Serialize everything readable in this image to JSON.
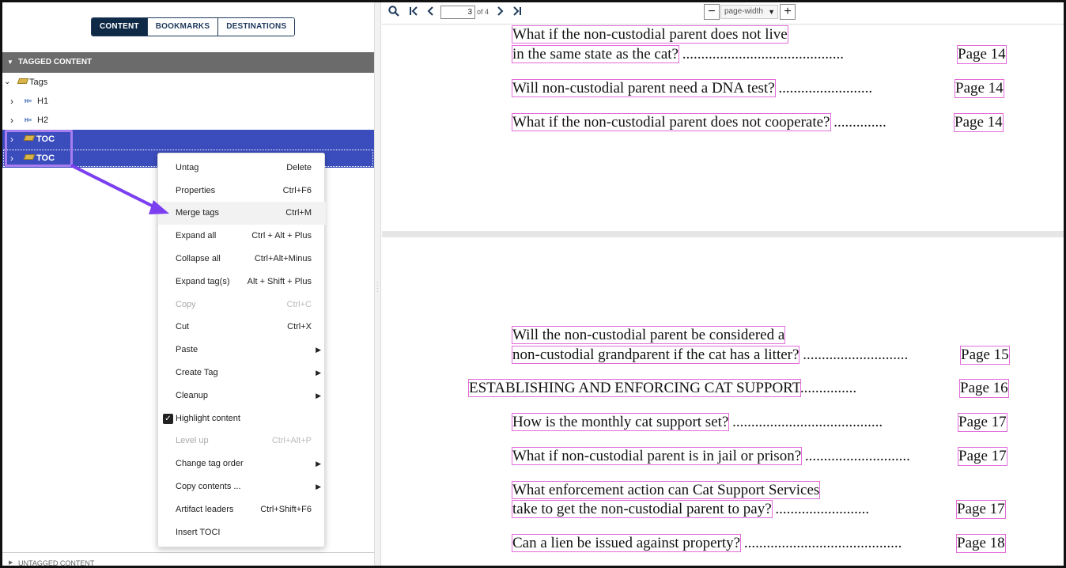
{
  "left_panel": {
    "tabs": [
      {
        "label": "CONTENT",
        "active": true
      },
      {
        "label": "BOOKMARKS",
        "active": false
      },
      {
        "label": "DESTINATIONS",
        "active": false
      }
    ],
    "tagged_header": "TAGGED CONTENT",
    "tree": {
      "root": "Tags",
      "items": [
        {
          "label": "H1",
          "icon": "heading-icon"
        },
        {
          "label": "H2",
          "icon": "heading-icon"
        },
        {
          "label": "TOC",
          "icon": "tag-icon",
          "selected": true
        },
        {
          "label": "TOC",
          "icon": "tag-icon",
          "selected": true
        }
      ]
    },
    "untagged_header": "UNTAGGED CONTENT"
  },
  "toolbar": {
    "current_page": "3",
    "page_of": "of 4",
    "zoom": "page-width",
    "icons": [
      "search-icon",
      "first-page-icon",
      "prev-page-icon",
      "next-page-icon",
      "last-page-icon"
    ]
  },
  "context_menu": [
    {
      "label": "Untag",
      "shortcut": "Delete"
    },
    {
      "label": "Properties",
      "shortcut": "Ctrl+F6"
    },
    {
      "label": "Merge tags",
      "shortcut": "Ctrl+M",
      "hover": true
    },
    {
      "label": "Expand all",
      "shortcut": "Ctrl + Alt + Plus"
    },
    {
      "label": "Collapse all",
      "shortcut": "Ctrl+Alt+Minus"
    },
    {
      "label": "Expand tag(s)",
      "shortcut": "Alt + Shift + Plus"
    },
    {
      "label": "Copy",
      "shortcut": "Ctrl+C",
      "disabled": true
    },
    {
      "label": "Cut",
      "shortcut": "Ctrl+X"
    },
    {
      "label": "Paste",
      "shortcut": "",
      "submenu": true
    },
    {
      "label": "Create Tag",
      "shortcut": "",
      "submenu": true
    },
    {
      "label": "Cleanup",
      "shortcut": "",
      "submenu": true
    },
    {
      "label": "Highlight content",
      "shortcut": "",
      "checked": true
    },
    {
      "label": "Level up",
      "shortcut": "Ctrl+Alt+P",
      "disabled": true
    },
    {
      "label": "Change tag order",
      "shortcut": "",
      "submenu": true
    },
    {
      "label": "Copy contents ...",
      "shortcut": "",
      "submenu": true
    },
    {
      "label": "Artifact leaders",
      "shortcut": "Ctrl+Shift+F6"
    },
    {
      "label": "Insert TOCI",
      "shortcut": ""
    }
  ],
  "document": {
    "page_top": [
      {
        "text": "What if the non-custodial parent does not live",
        "page": ""
      },
      {
        "text": "in the same state as the cat?",
        "leader": " ...........................................",
        "page": "Page 14"
      },
      {
        "text": "Will non-custodial parent need a DNA test?",
        "leader": " .........................",
        "page": "Page 14"
      },
      {
        "text": "What if the non-custodial parent does not cooperate?",
        "leader": " ..............",
        "page": "Page 14"
      }
    ],
    "page_bottom": [
      {
        "text": "Will the non-custodial parent be considered a",
        "page": ""
      },
      {
        "text": "non-custodial grandparent if the cat has a litter?",
        "leader": " ............................",
        "page": "Page 15"
      },
      {
        "text": "ESTABLISHING AND ENFORCING CAT SUPPORT",
        "leader": "...............",
        "page": "Page 16"
      },
      {
        "text": "How is the monthly cat support set?",
        "leader": " ........................................",
        "page": "Page 17"
      },
      {
        "text": "What if non-custodial parent is in jail or prison?",
        "leader": " ............................",
        "page": "Page 17"
      },
      {
        "text": "What enforcement action can Cat Support Services",
        "page": ""
      },
      {
        "text": "take to get the non-custodial parent to pay?",
        "leader": " .........................",
        "page": "Page 17"
      },
      {
        "text": "Can a lien be issued against property?",
        "leader": " ..........................................",
        "page": "Page 18"
      }
    ]
  },
  "colors": {
    "selection": "#3b4dbd",
    "highlight_outline": "#e36bd9",
    "annotation_arrow": "#7b3ff0"
  }
}
